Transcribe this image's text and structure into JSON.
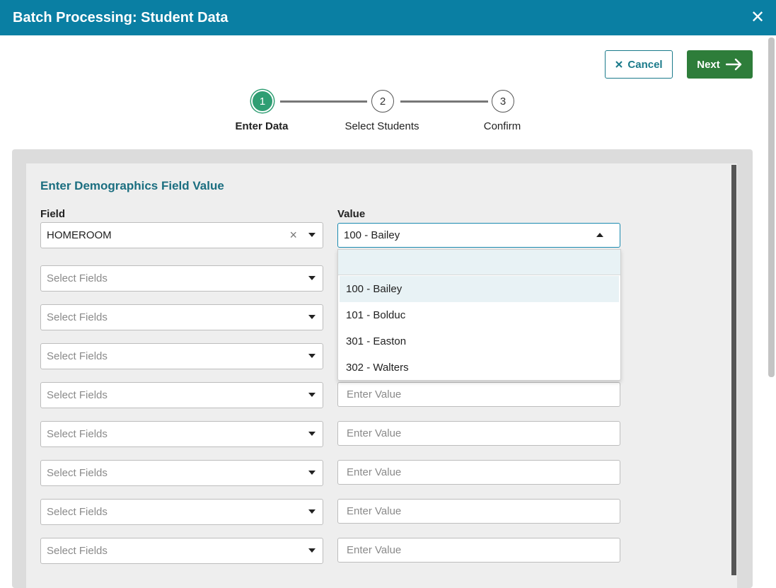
{
  "window": {
    "title": "Batch Processing: Student Data",
    "close_glyph": "✕"
  },
  "actions": {
    "cancel_label": "Cancel",
    "cancel_icon": "close-icon",
    "next_label": "Next",
    "next_icon": "arrow-right-icon"
  },
  "stepper": {
    "active_index": 0,
    "steps": [
      {
        "number": "1",
        "label": "Enter Data"
      },
      {
        "number": "2",
        "label": "Select Students"
      },
      {
        "number": "3",
        "label": "Confirm"
      }
    ]
  },
  "form": {
    "section_title": "Enter Demographics Field Value",
    "field_label": "Field",
    "value_label": "Value",
    "first_row": {
      "field": "HOMEROOM",
      "value": "100 - Bailey"
    },
    "field_placeholder": "Select Fields",
    "value_placeholder": "Enter Value",
    "dropdown_options": [
      "100 - Bailey",
      "101 - Bolduc",
      "301 - Easton",
      "302 - Walters"
    ],
    "selected_option": "100 - Bailey"
  },
  "colors": {
    "header": "#0a7fa3",
    "accent": "#1b6e80",
    "next_button": "#2e7d3a",
    "active_step": "#2f9e73"
  }
}
